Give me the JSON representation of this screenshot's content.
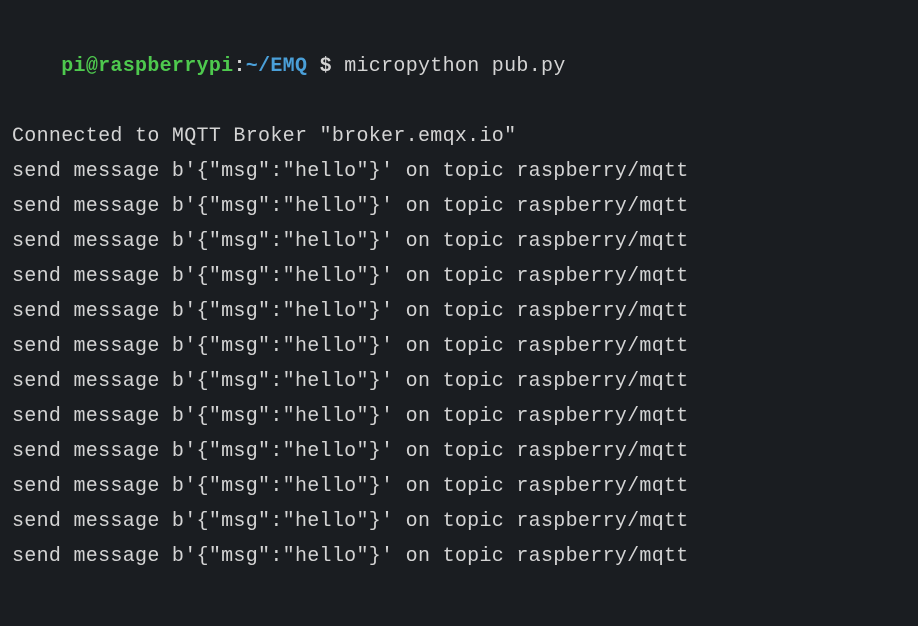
{
  "prompt": {
    "user_host": "pi@raspberrypi",
    "colon": ":",
    "path": "~/EMQ",
    "dollar": " $ ",
    "command": "micropython pub.py"
  },
  "output": {
    "connected_line": "Connected to MQTT Broker \"broker.emqx.io\"",
    "message_lines": [
      "send message b'{\"msg\":\"hello\"}' on topic raspberry/mqtt",
      "send message b'{\"msg\":\"hello\"}' on topic raspberry/mqtt",
      "send message b'{\"msg\":\"hello\"}' on topic raspberry/mqtt",
      "send message b'{\"msg\":\"hello\"}' on topic raspberry/mqtt",
      "send message b'{\"msg\":\"hello\"}' on topic raspberry/mqtt",
      "send message b'{\"msg\":\"hello\"}' on topic raspberry/mqtt",
      "send message b'{\"msg\":\"hello\"}' on topic raspberry/mqtt",
      "send message b'{\"msg\":\"hello\"}' on topic raspberry/mqtt",
      "send message b'{\"msg\":\"hello\"}' on topic raspberry/mqtt",
      "send message b'{\"msg\":\"hello\"}' on topic raspberry/mqtt",
      "send message b'{\"msg\":\"hello\"}' on topic raspberry/mqtt",
      "send message b'{\"msg\":\"hello\"}' on topic raspberry/mqtt"
    ]
  }
}
